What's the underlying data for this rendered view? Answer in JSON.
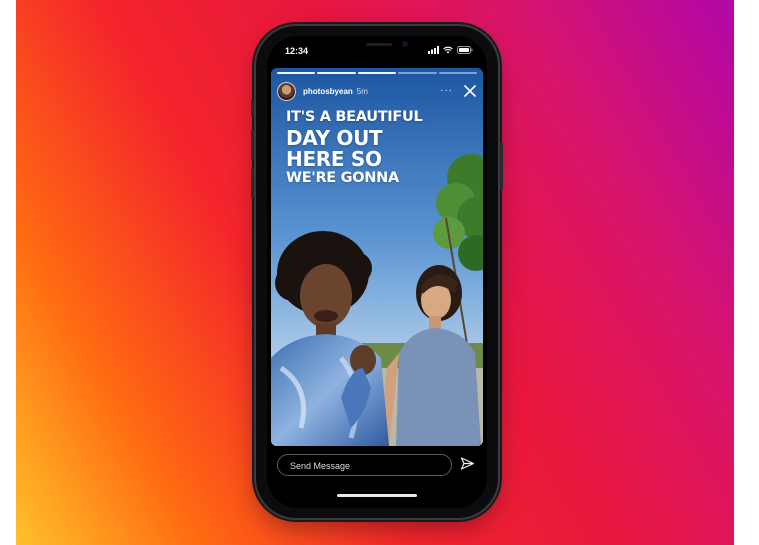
{
  "status_bar": {
    "time": "12:34",
    "icons": [
      "signal-icon",
      "wifi-icon",
      "battery-icon"
    ]
  },
  "story": {
    "progress": {
      "segments": 5,
      "completed": 3
    },
    "username": "photosbyean",
    "time_ago": "5m",
    "more_label": "···",
    "overlay_lines": [
      "IT'S A BEAUTIFUL",
      "DAY OUT",
      "HERE SO",
      "WE'RE GONNA"
    ]
  },
  "reply": {
    "placeholder": "Send Message"
  },
  "colors": {
    "background_gradient": [
      "#ffc12a",
      "#ff6a12",
      "#f4262b",
      "#e8163d",
      "#d8146b",
      "#b107a8"
    ],
    "phone_body": "#0c0c0f",
    "text": "#ffffff"
  }
}
